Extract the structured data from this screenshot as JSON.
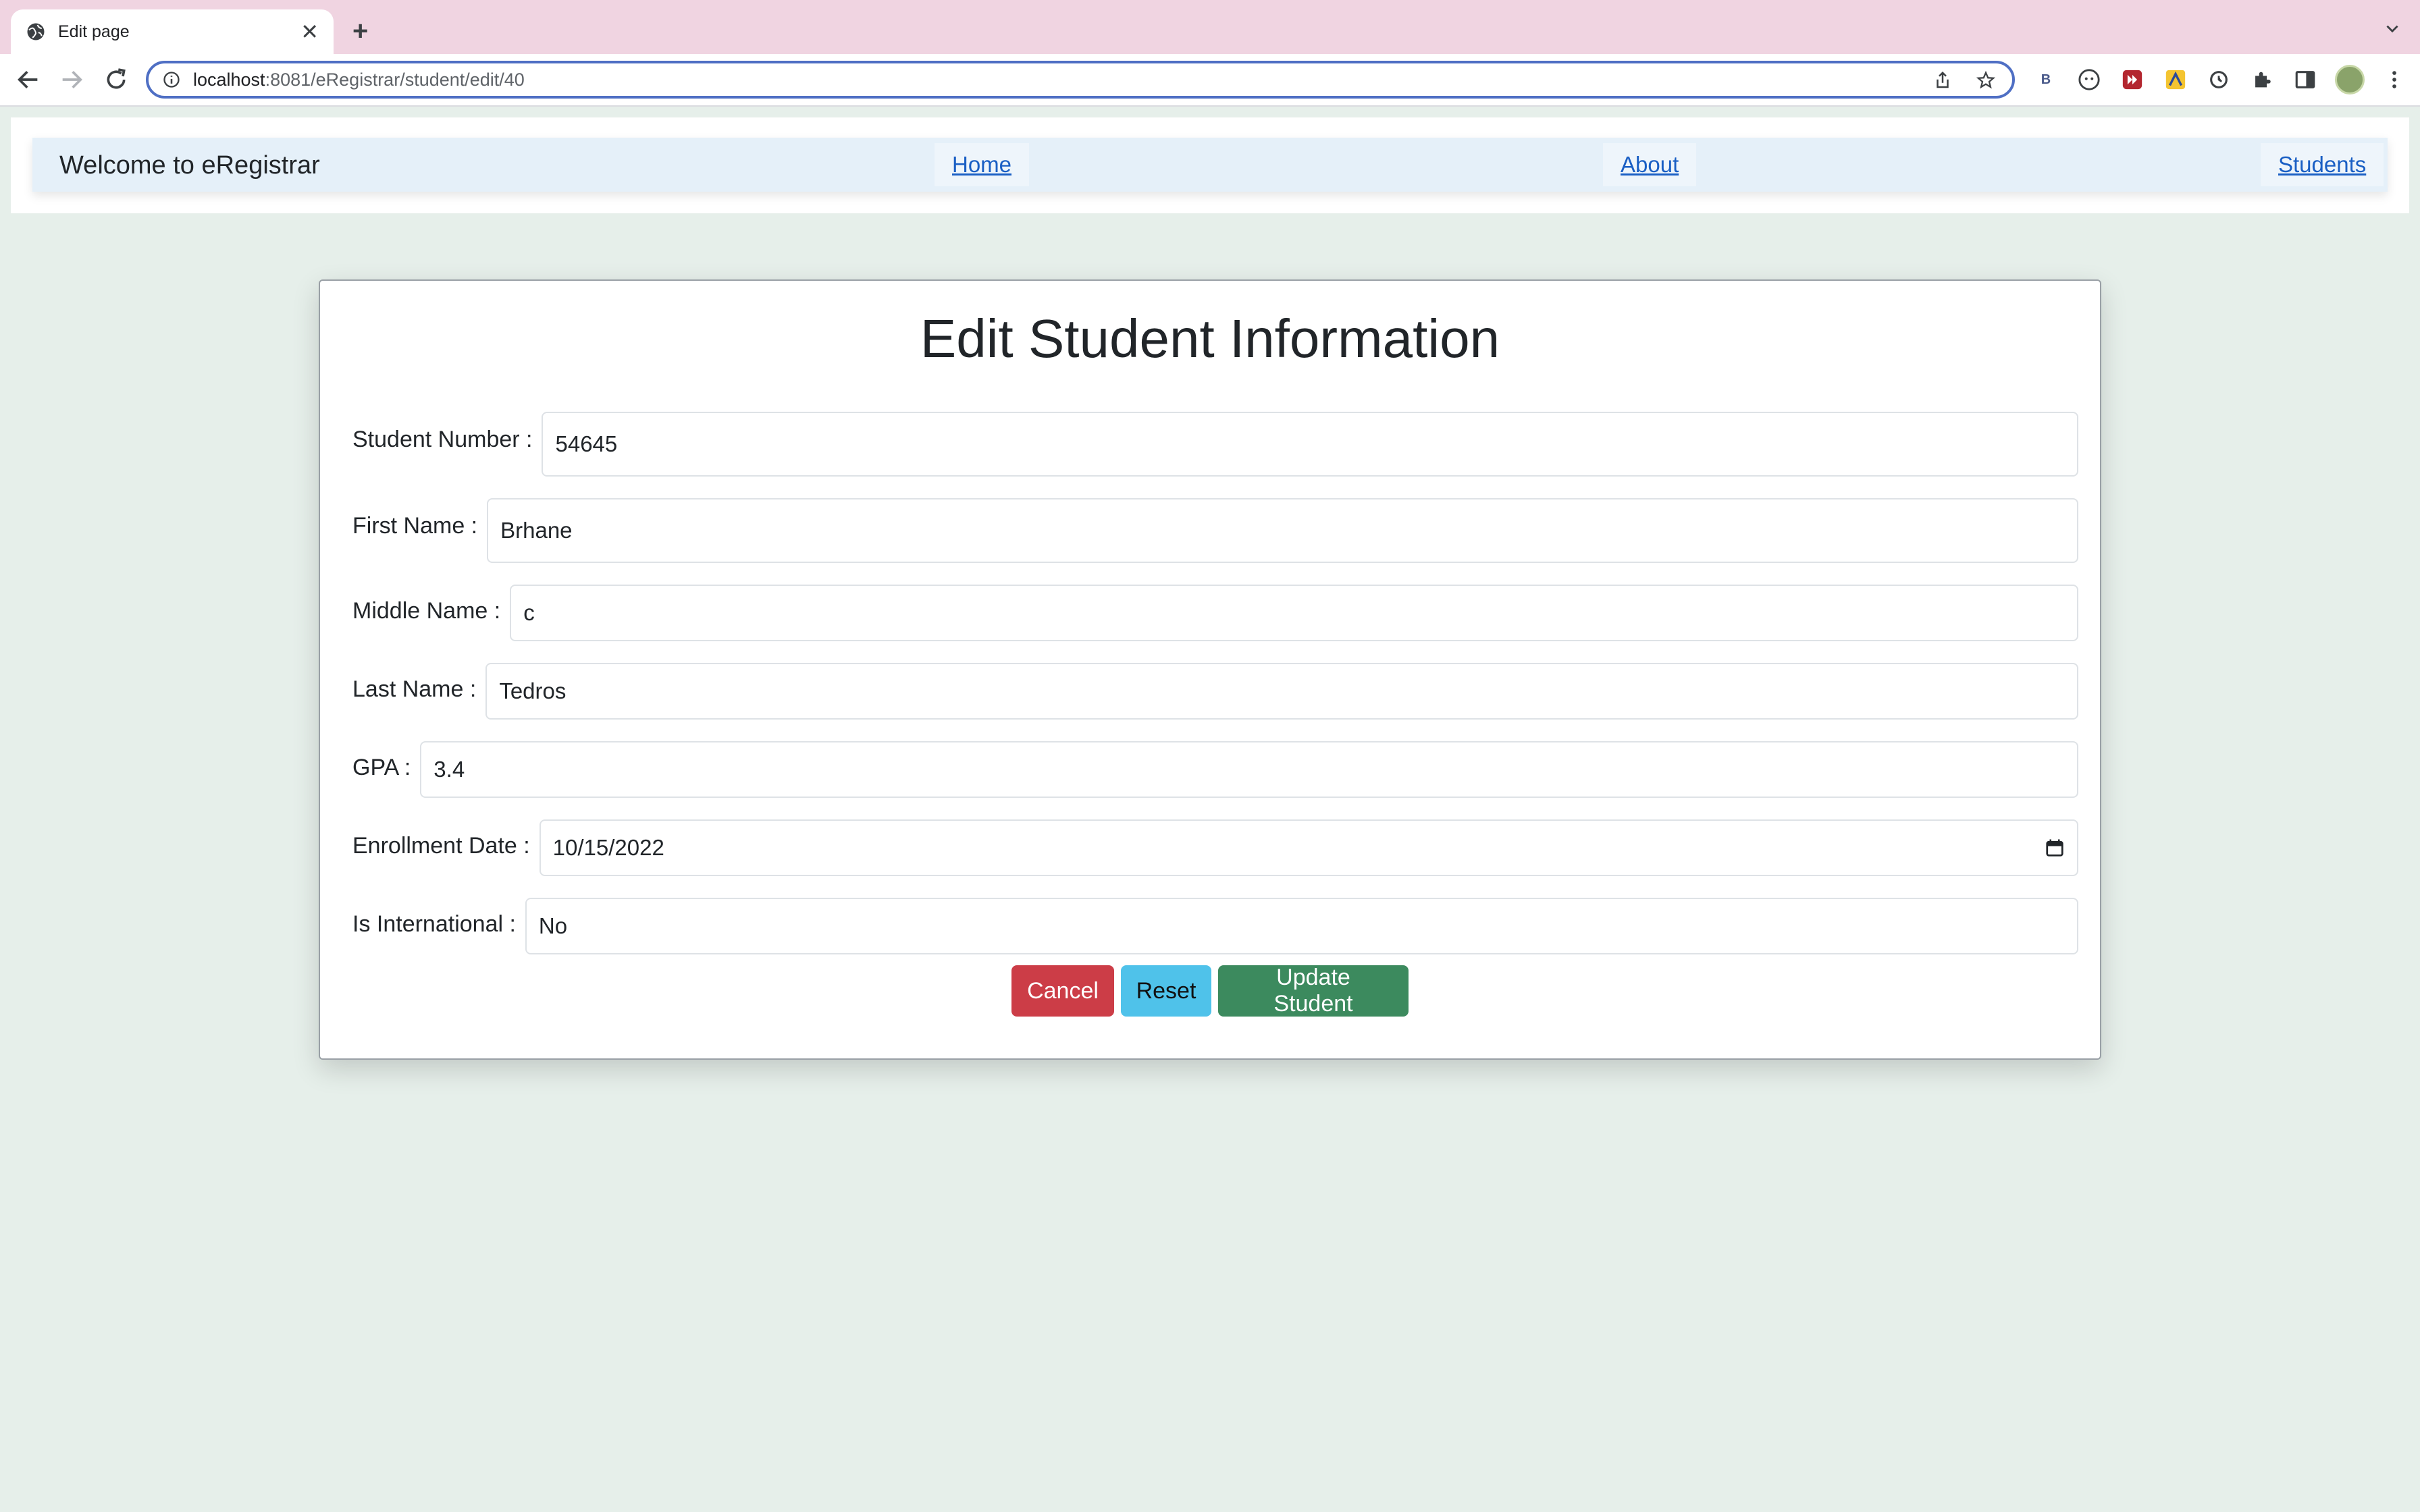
{
  "browser": {
    "tab_title": "Edit page",
    "url_host": "localhost",
    "url_rest": ":8081/eRegistrar/student/edit/40",
    "extension_b_label": "B"
  },
  "navbar": {
    "brand": "Welcome to eRegistrar",
    "links": [
      "Home",
      "About",
      "Students"
    ]
  },
  "form": {
    "title": "Edit Student Information",
    "fields": [
      {
        "label": "Student Number :",
        "value": "54645"
      },
      {
        "label": "First Name :",
        "value": "Brhane"
      },
      {
        "label": "Middle Name :",
        "value": "c"
      },
      {
        "label": "Last Name :",
        "value": "Tedros"
      },
      {
        "label": "GPA :",
        "value": "3.4"
      },
      {
        "label": "Enrollment Date :",
        "value": "10/15/2022"
      },
      {
        "label": "Is International :",
        "value": "No"
      }
    ],
    "buttons": {
      "cancel": "Cancel",
      "reset": "Reset",
      "update": "Update Student"
    }
  },
  "colors": {
    "page_bg": "#e6efea",
    "tabstrip_bg": "#f0d4e1",
    "navbar_bg": "#e5f0f9",
    "link": "#1a5fc4",
    "cancel": "#cc3d47",
    "reset": "#4fc2ea",
    "update": "#3c8a5e"
  }
}
